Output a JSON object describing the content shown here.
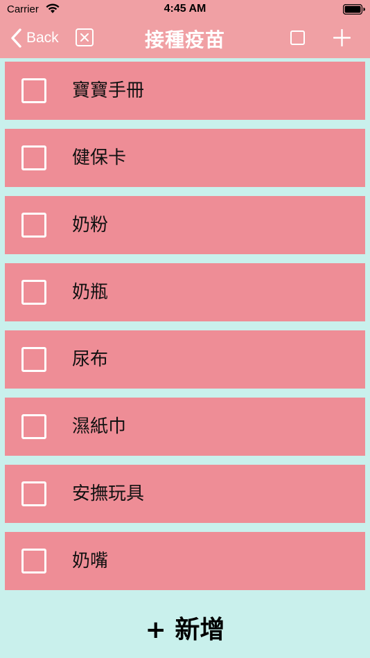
{
  "status_bar": {
    "carrier": "Carrier",
    "time": "4:45 AM"
  },
  "nav": {
    "back_label": "Back",
    "title": "接種疫苗"
  },
  "items": [
    {
      "label": "寶寶手冊",
      "checked": false
    },
    {
      "label": "健保卡",
      "checked": false
    },
    {
      "label": "奶粉",
      "checked": false
    },
    {
      "label": "奶瓶",
      "checked": false
    },
    {
      "label": "尿布",
      "checked": false
    },
    {
      "label": "濕紙巾",
      "checked": false
    },
    {
      "label": "安撫玩具",
      "checked": false
    },
    {
      "label": "奶嘴",
      "checked": false
    }
  ],
  "add_button": {
    "label": "+ 新增"
  },
  "colors": {
    "nav_background": "#f0a0a4",
    "item_background": "#ee8d96",
    "page_background": "#c9f0ec"
  }
}
